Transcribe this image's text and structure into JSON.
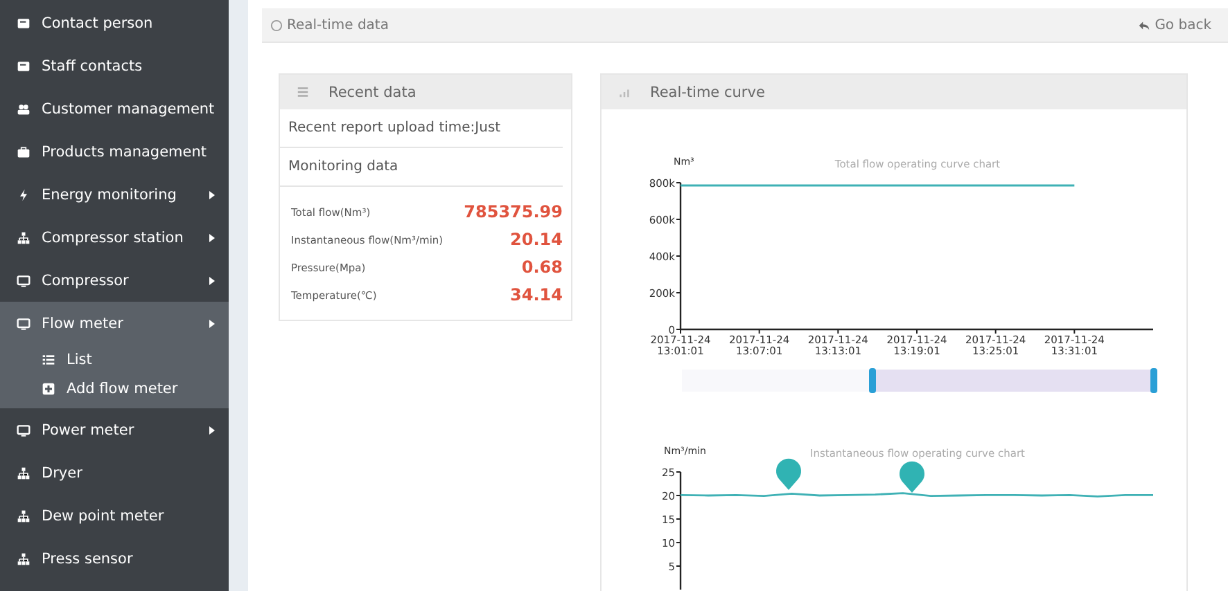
{
  "sidebar": {
    "items": [
      {
        "label": "Contact person",
        "submenu": false,
        "expanded": false
      },
      {
        "label": "Staff contacts",
        "submenu": false,
        "expanded": false
      },
      {
        "label": "Customer management",
        "submenu": false,
        "expanded": false
      },
      {
        "label": "Products management",
        "submenu": false,
        "expanded": false
      },
      {
        "label": "Energy monitoring",
        "submenu": true,
        "expanded": false
      },
      {
        "label": "Compressor station",
        "submenu": true,
        "expanded": false
      },
      {
        "label": "Compressor",
        "submenu": true,
        "expanded": false
      },
      {
        "label": "Flow meter",
        "submenu": true,
        "expanded": true,
        "children": [
          {
            "label": "List"
          },
          {
            "label": "Add flow meter"
          }
        ]
      },
      {
        "label": "Power meter",
        "submenu": true,
        "expanded": false
      },
      {
        "label": "Dryer",
        "submenu": false,
        "expanded": false
      },
      {
        "label": "Dew point meter",
        "submenu": false,
        "expanded": false
      },
      {
        "label": "Press sensor",
        "submenu": false,
        "expanded": false
      }
    ]
  },
  "header": {
    "title": "Real-time data",
    "back": "Go back"
  },
  "recent": {
    "title": "Recent data",
    "upload": "Recent report upload time:Just",
    "section": "Monitoring data",
    "rows": [
      {
        "label": "Total flow(Nm³)",
        "value": "785375.99"
      },
      {
        "label": "Instantaneous flow(Nm³/min)",
        "value": "20.14"
      },
      {
        "label": "Pressure(Mpa)",
        "value": "0.68"
      },
      {
        "label": "Temperature(℃)",
        "value": "34.14"
      }
    ]
  },
  "curve": {
    "title": "Real-time curve",
    "charts": [
      {
        "chart_data": {
          "type": "line",
          "title": "Total flow operating curve chart",
          "ylabel": "Nm³",
          "categories": [
            "2017-11-24 13:01:01",
            "2017-11-24 13:07:01",
            "2017-11-24 13:13:01",
            "2017-11-24 13:19:01",
            "2017-11-24 13:25:01",
            "2017-11-24 13:31:01"
          ],
          "series": [
            {
              "color": "#3fb1b5",
              "values": [
                785000,
                785000,
                785000,
                785000,
                785000,
                785000
              ]
            }
          ],
          "ylim": [
            0,
            800000
          ],
          "yticks": [
            {
              "value": 0,
              "label": "0"
            },
            {
              "value": 200000,
              "label": "200k"
            },
            {
              "value": 400000,
              "label": "400k"
            },
            {
              "value": 600000,
              "label": "600k"
            },
            {
              "value": 800000,
              "label": "800k"
            }
          ]
        }
      },
      {
        "chart_data": {
          "type": "line",
          "title": "Instantaneous flow operating curve chart",
          "ylabel": "Nm³/min",
          "series": [
            {
              "color": "#3fb1b5",
              "values": [
                20.1,
                20.0,
                20.1,
                19.9,
                20.4,
                20.0,
                20.1,
                20.2,
                20.5,
                19.9,
                20.0,
                20.1,
                20.1,
                20.0,
                20.1,
                19.8,
                20.1,
                20.1
              ]
            }
          ],
          "ylim": [
            0,
            25
          ],
          "yticks": [
            5,
            10,
            15,
            20,
            25
          ]
        }
      }
    ]
  }
}
